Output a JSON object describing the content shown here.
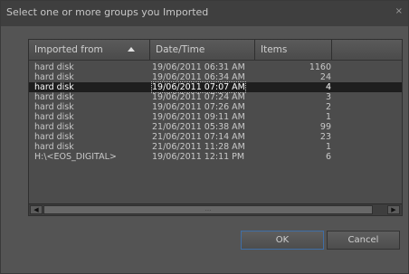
{
  "dialog": {
    "title": "Select one or more groups you Imported",
    "close_label": "×"
  },
  "table": {
    "columns": [
      "Imported from",
      "Date/Time",
      "Items"
    ],
    "sorted_column": "Imported from",
    "rows": [
      {
        "from": "hard disk",
        "datetime": "19/06/2011 06:31 AM",
        "items": "1160"
      },
      {
        "from": "hard disk",
        "datetime": "19/06/2011 06:34 AM",
        "items": "24"
      },
      {
        "from": "hard disk",
        "datetime": "19/06/2011 07:07 AM",
        "items": "4",
        "selected": true
      },
      {
        "from": "hard disk",
        "datetime": "19/06/2011 07:24 AM",
        "items": "3"
      },
      {
        "from": "hard disk",
        "datetime": "19/06/2011 07:26 AM",
        "items": "2"
      },
      {
        "from": "hard disk",
        "datetime": "19/06/2011 09:11 AM",
        "items": "1"
      },
      {
        "from": "hard disk",
        "datetime": "21/06/2011 05:38 AM",
        "items": "99"
      },
      {
        "from": "hard disk",
        "datetime": "21/06/2011 07:14 AM",
        "items": "23"
      },
      {
        "from": "hard disk",
        "datetime": "21/06/2011 11:28 AM",
        "items": "1"
      },
      {
        "from": "H:\\<EOS_DIGITAL>",
        "datetime": "19/06/2011 12:11 PM",
        "items": "6"
      }
    ]
  },
  "scrollbar": {
    "left_icon": "◀",
    "right_icon": "▶",
    "thumb_grip": "..."
  },
  "buttons": {
    "ok": "OK",
    "cancel": "Cancel"
  }
}
